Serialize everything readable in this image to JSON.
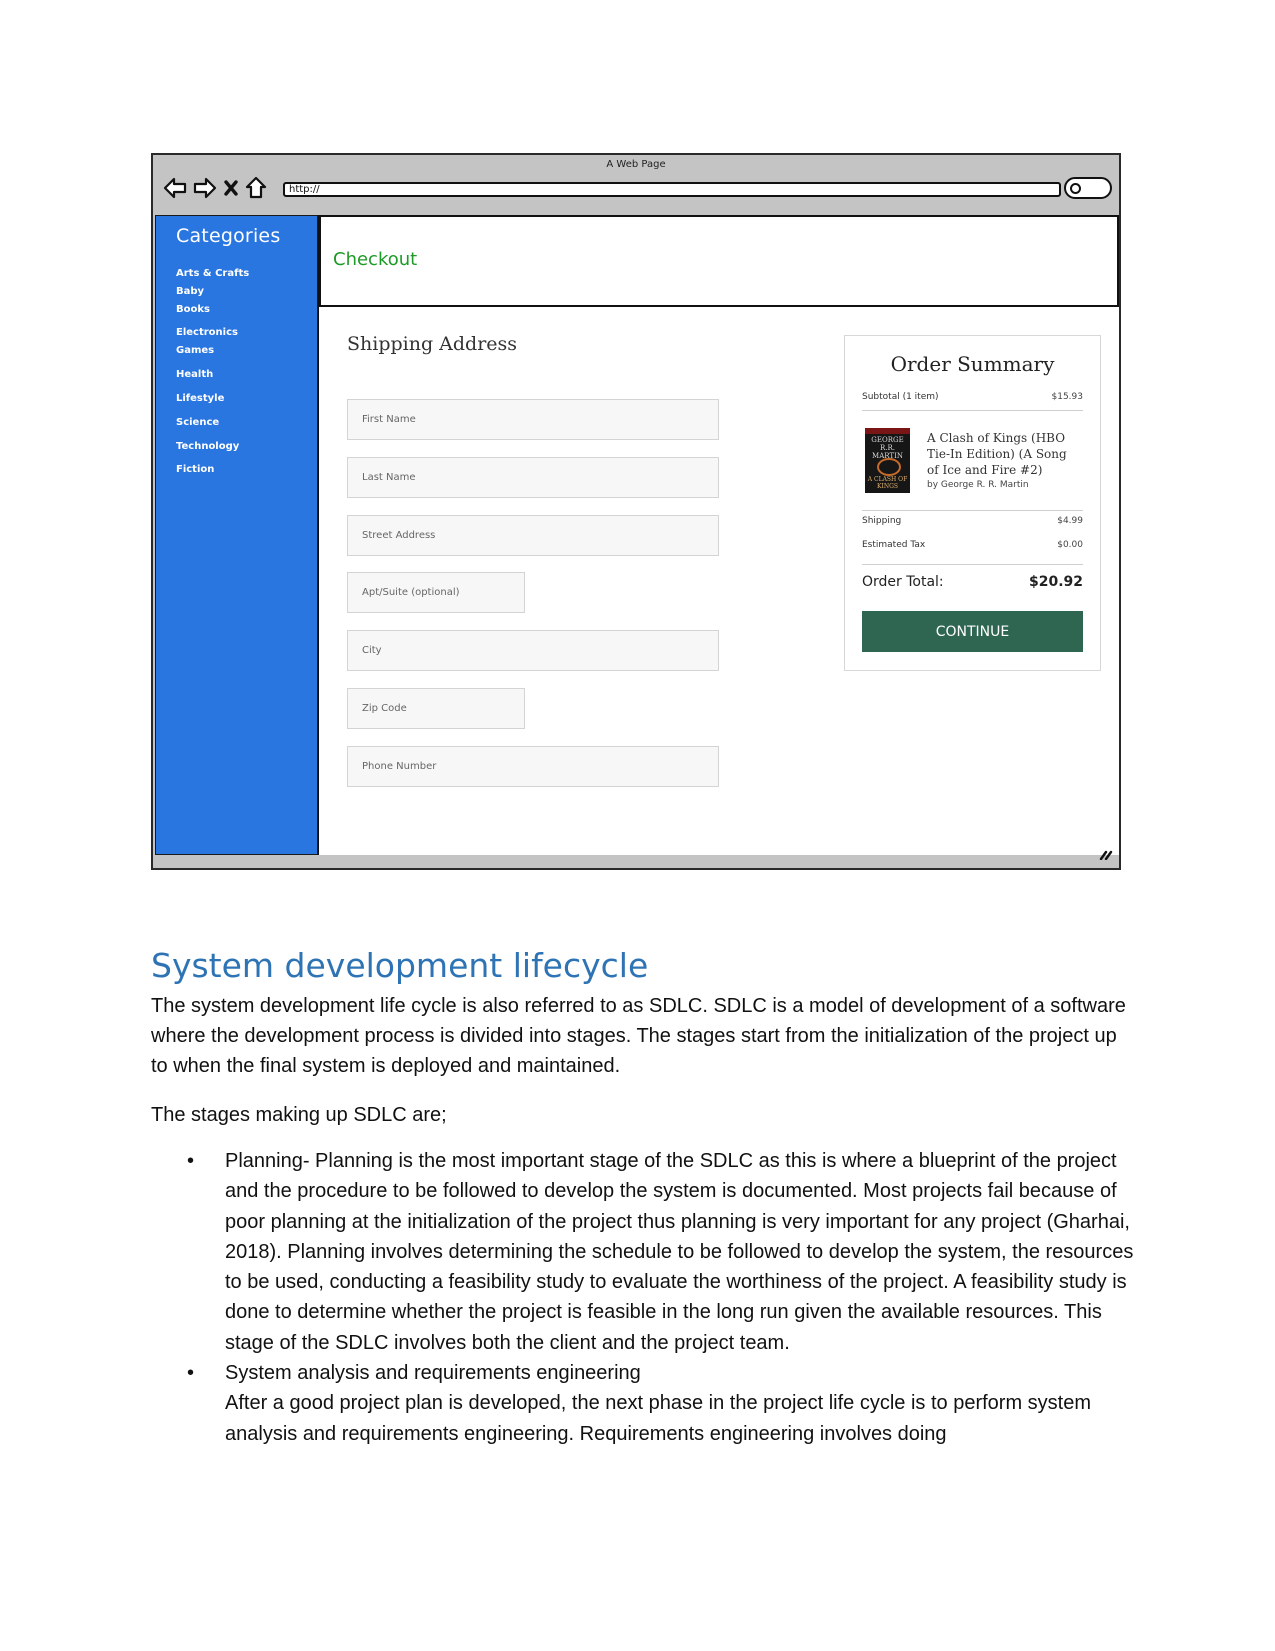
{
  "wireframe": {
    "window_title": "A Web Page",
    "url": "http://",
    "nav_icons": [
      "back-arrow-icon",
      "forward-arrow-icon",
      "close-x-icon",
      "home-icon"
    ],
    "sidebar": {
      "title": "Categories",
      "items": [
        "Arts & Crafts",
        "Baby",
        "Books",
        "Electronics",
        "Games",
        "Health",
        "Lifestyle",
        "Science",
        "Technology",
        "Fiction"
      ],
      "color": "#2a76e0"
    },
    "header": {
      "title": "Checkout",
      "color": "#1e9a27"
    },
    "shipping": {
      "title": "Shipping Address",
      "fields": [
        {
          "placeholder": "First Name",
          "size": "wide"
        },
        {
          "placeholder": "Last Name",
          "size": "wide"
        },
        {
          "placeholder": "Street Address",
          "size": "wide"
        },
        {
          "placeholder": "Apt/Suite (optional)",
          "size": "narrow"
        },
        {
          "placeholder": "City",
          "size": "wide"
        },
        {
          "placeholder": "Zip Code",
          "size": "narrow"
        },
        {
          "placeholder": "Phone Number",
          "size": "wide"
        }
      ]
    },
    "order_summary": {
      "title": "Order Summary",
      "subtotal_label": "Subtotal (1 item)",
      "subtotal_value": "$15.93",
      "item": {
        "title": "A Clash of Kings (HBO Tie-In Edition) (A Song of Ice and Fire #2)",
        "author": "by George R. R. Martin",
        "cover_author": "GEORGE R.R. MARTIN",
        "cover_title": "A CLASH OF KINGS"
      },
      "shipping_label": "Shipping",
      "shipping_value": "$4.99",
      "tax_label": "Estimated Tax",
      "tax_value": "$0.00",
      "total_label": "Order Total:",
      "total_value": "$20.92",
      "continue_label": "CONTINUE",
      "button_color": "#2f6651"
    }
  },
  "document": {
    "heading": "System development lifecycle",
    "heading_color": "#2e74b5",
    "intro": "The system development life cycle is also referred to as SDLC. SDLC is a model of development of a software where the development process is divided into stages. The stages start from the initialization of the project up to when the final system is deployed and maintained.",
    "stages_intro": "The stages making up SDLC are;",
    "bullets": [
      {
        "text": "Planning- Planning is the most important stage of the SDLC as this is where a blueprint of the project and the procedure to be followed to develop the system is documented. Most projects fail because of poor planning at the initialization of the project thus planning is very important for any project (Gharhai, 2018). Planning involves determining the schedule to be followed to develop the system, the resources to be used, conducting a feasibility study to evaluate the worthiness of the project. A feasibility study is done to determine whether the project is feasible in the long run given the available resources. This stage of the SDLC involves both the client and the project team."
      },
      {
        "text": "System analysis and requirements engineering",
        "continuation": "After a good project plan is developed, the next phase in the project life cycle is to perform system analysis and requirements engineering. Requirements engineering involves doing"
      }
    ]
  }
}
